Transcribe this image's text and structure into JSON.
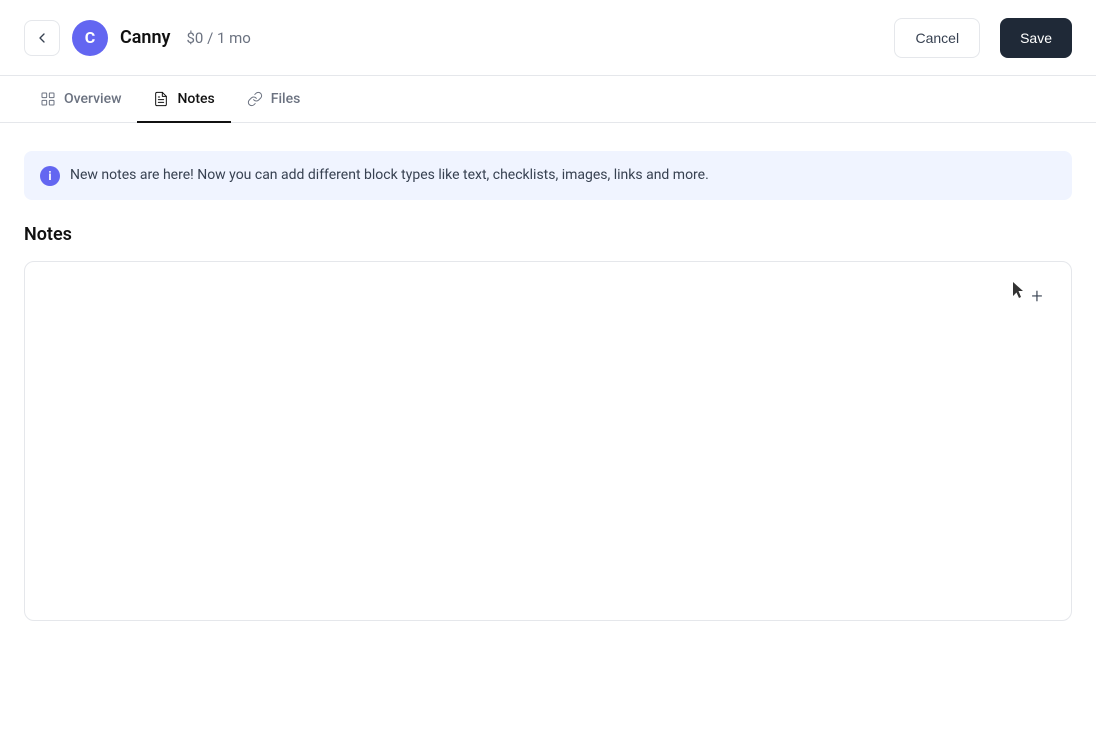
{
  "header": {
    "back_label": "←",
    "app_initial": "C",
    "app_name": "Canny",
    "app_pricing": "$0 / 1 mo",
    "cancel_label": "Cancel",
    "save_label": "Save"
  },
  "tabs": [
    {
      "id": "overview",
      "label": "Overview",
      "icon": "overview-icon",
      "active": false
    },
    {
      "id": "notes",
      "label": "Notes",
      "icon": "notes-icon",
      "active": true
    },
    {
      "id": "files",
      "label": "Files",
      "icon": "files-icon",
      "active": false
    }
  ],
  "info_banner": {
    "text": "New notes are here! Now you can add different block types like text, checklists, images, links and more."
  },
  "notes_section": {
    "title": "Notes",
    "add_block_symbol": "+"
  }
}
